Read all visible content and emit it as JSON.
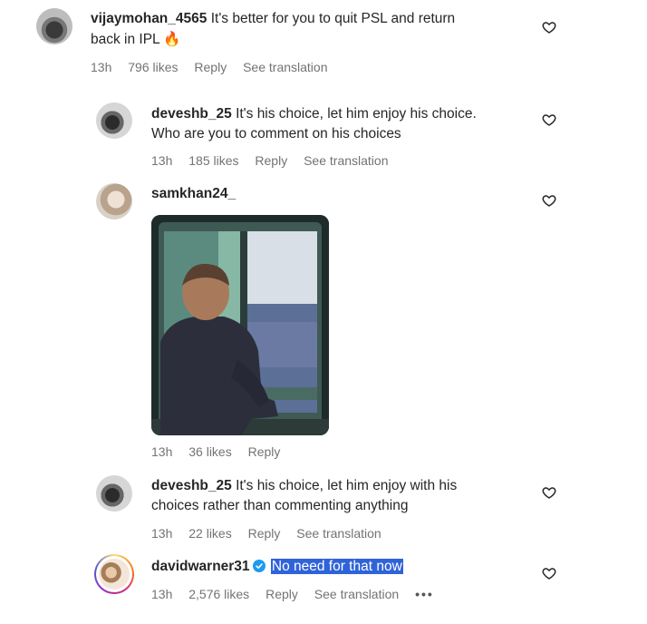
{
  "comments": [
    {
      "username": "vijaymohan_4565",
      "text_line1": "It's better for you to quit PSL and return",
      "text_line2": "back in IPL",
      "emoji": "🔥",
      "time": "13h",
      "likes": "796 likes",
      "reply": "Reply",
      "translate": "See translation"
    },
    {
      "username": "deveshb_25",
      "text_line1": "It's his choice, let him enjoy his choice.",
      "text_line2": "Who are you to comment on his choices",
      "time": "13h",
      "likes": "185 likes",
      "reply": "Reply",
      "translate": "See translation"
    },
    {
      "username": "samkhan24_",
      "time": "13h",
      "likes": "36 likes",
      "reply": "Reply"
    },
    {
      "username": "deveshb_25",
      "text_line1": "It's his choice, let him enjoy with his",
      "text_line2": "choices rather than commenting anything",
      "time": "13h",
      "likes": "22 likes",
      "reply": "Reply",
      "translate": "See translation"
    },
    {
      "username": "davidwarner31",
      "verified": true,
      "text_line1": "No need for that now",
      "time": "13h",
      "likes": "2,576 likes",
      "reply": "Reply",
      "translate": "See translation",
      "more": "•••"
    }
  ],
  "icons": {
    "like": "heart-outline-icon",
    "verified": "verified-badge-icon",
    "more": "more-options-icon"
  },
  "colors": {
    "text": "#262626",
    "meta": "#737373",
    "verified": "#1d9bf0",
    "highlight": "#2f63d8"
  }
}
